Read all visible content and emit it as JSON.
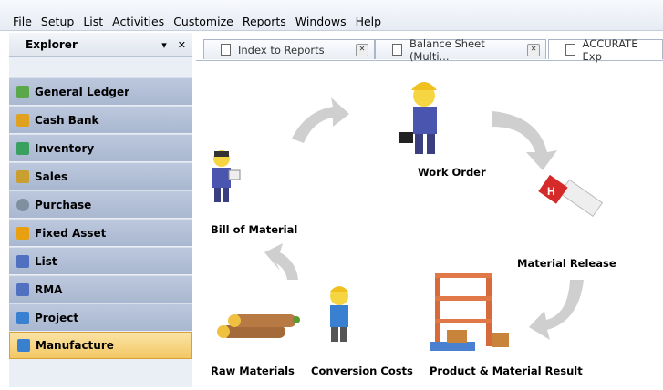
{
  "menu": [
    "File",
    "Setup",
    "List",
    "Activities",
    "Customize",
    "Reports",
    "Windows",
    "Help"
  ],
  "explorer": {
    "title": "Explorer",
    "pin": "▾",
    "close": "✕",
    "items": [
      {
        "label": "General Ledger",
        "color": "#5aa84a"
      },
      {
        "label": "Cash Bank",
        "color": "#e0a020"
      },
      {
        "label": "Inventory",
        "color": "#3aa060"
      },
      {
        "label": "Sales",
        "color": "#c9a030"
      },
      {
        "label": "Purchase",
        "color": "#8090a0"
      },
      {
        "label": "Fixed Asset",
        "color": "#e8a010"
      },
      {
        "label": "List",
        "color": "#5070c0"
      },
      {
        "label": "RMA",
        "color": "#5070c0"
      },
      {
        "label": "Project",
        "color": "#3a80d0"
      },
      {
        "label": "Manufacture",
        "color": "#3a80d0"
      }
    ]
  },
  "tabs": [
    "Index to Reports",
    "Balance Sheet (Multi...",
    "ACCURATE Exp"
  ],
  "diagram": {
    "work_order": "Work Order",
    "bill_of_material": "Bill of Material",
    "material_release": "Material Release",
    "raw_materials": "Raw Materials",
    "conversion_costs": "Conversion Costs",
    "product_result": "Product & Material Result"
  }
}
